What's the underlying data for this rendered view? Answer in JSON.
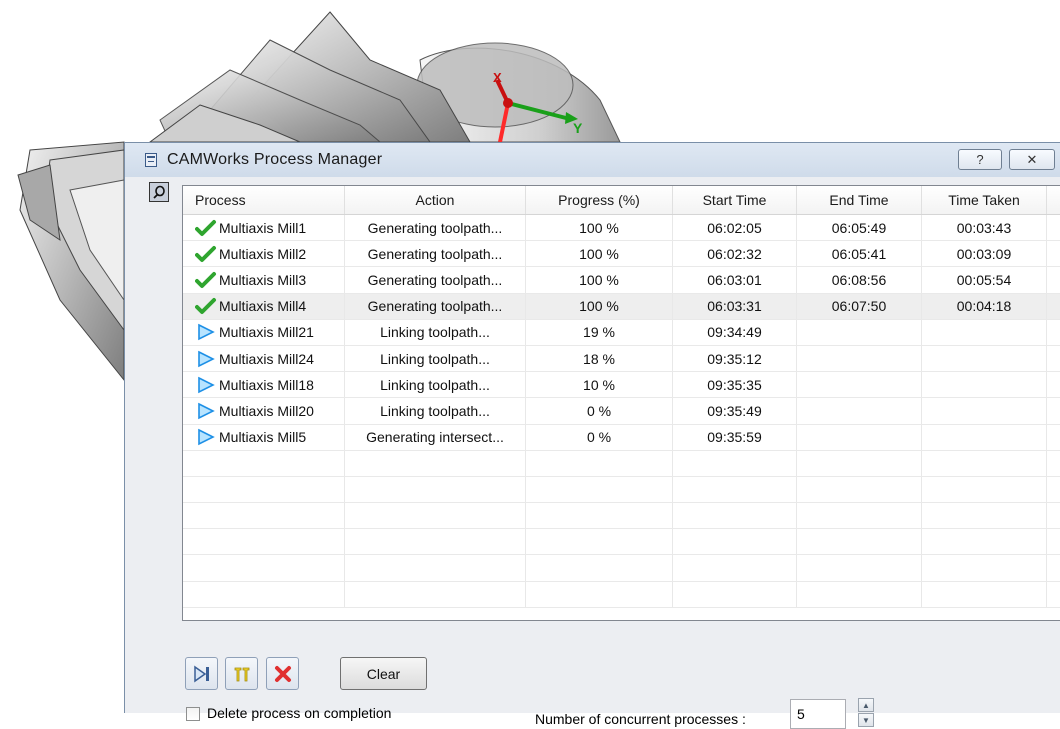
{
  "window": {
    "title": "CAMWorks Process Manager",
    "help_label": "?",
    "close_label": "✕"
  },
  "list": {
    "columns": [
      "Process",
      "Action",
      "Progress (%)",
      "Start Time",
      "End Time",
      "Time Taken"
    ],
    "rows": [
      {
        "status": "completed",
        "process": "Multiaxis Mill1",
        "action": "Generating toolpath...",
        "progress": "100 %",
        "start": "06:02:05",
        "end": "06:05:49",
        "taken": "00:03:43"
      },
      {
        "status": "completed",
        "process": "Multiaxis Mill2",
        "action": "Generating toolpath...",
        "progress": "100 %",
        "start": "06:02:32",
        "end": "06:05:41",
        "taken": "00:03:09"
      },
      {
        "status": "completed",
        "process": "Multiaxis Mill3",
        "action": "Generating toolpath...",
        "progress": "100 %",
        "start": "06:03:01",
        "end": "06:08:56",
        "taken": "00:05:54"
      },
      {
        "status": "completed",
        "process": "Multiaxis Mill4",
        "action": "Generating toolpath...",
        "progress": "100 %",
        "start": "06:03:31",
        "end": "06:07:50",
        "taken": "00:04:18"
      },
      {
        "status": "running",
        "process": "Multiaxis Mill21",
        "action": "Linking toolpath...",
        "progress": "19 %",
        "start": "09:34:49",
        "end": "",
        "taken": ""
      },
      {
        "status": "running",
        "process": "Multiaxis Mill24",
        "action": "Linking toolpath...",
        "progress": "18 %",
        "start": "09:35:12",
        "end": "",
        "taken": ""
      },
      {
        "status": "running",
        "process": "Multiaxis Mill18",
        "action": "Linking toolpath...",
        "progress": "10 %",
        "start": "09:35:35",
        "end": "",
        "taken": ""
      },
      {
        "status": "running",
        "process": "Multiaxis Mill20",
        "action": "Linking toolpath...",
        "progress": "0 %",
        "start": "09:35:49",
        "end": "",
        "taken": ""
      },
      {
        "status": "running",
        "process": "Multiaxis Mill5",
        "action": "Generating intersect...",
        "progress": "0 %",
        "start": "09:35:59",
        "end": "",
        "taken": ""
      }
    ],
    "selected_row": 3,
    "empty_rows": 6
  },
  "controls": {
    "play_icon": "play-icon",
    "pause_icon": "pause-icon",
    "stop_icon": "stop-icon",
    "clear_label": "Clear",
    "delete_on_completion_label": "Delete process on completion",
    "delete_on_completion_checked": false,
    "concurrent_label": "Number of concurrent processes :",
    "concurrent_value": "5"
  },
  "axes": {
    "x_label": "X",
    "y_label": "Y"
  },
  "colors": {
    "check_green": "#2fa52f",
    "run_blue": "#1e90e6",
    "stop_red": "#e03030",
    "pause_yellow": "#e8d020"
  }
}
